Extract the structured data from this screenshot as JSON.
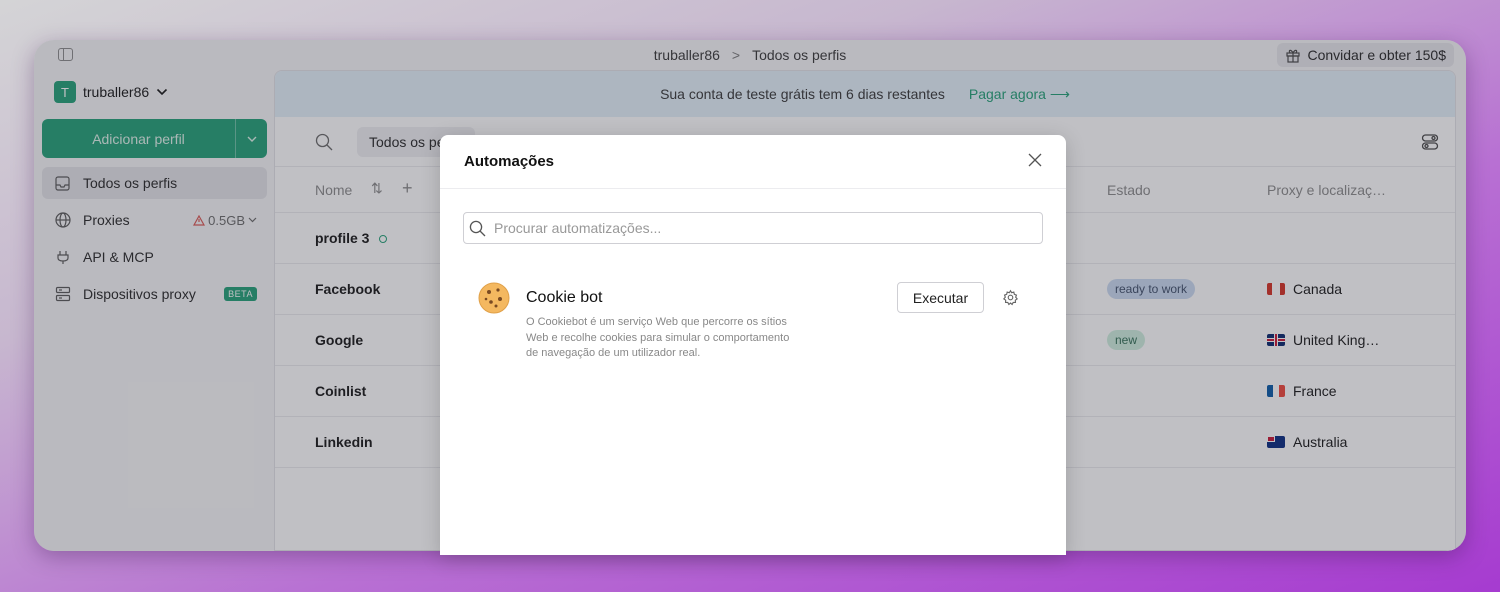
{
  "titlebar": {
    "account": "truballer86",
    "separator": ">",
    "page": "Todos os perfis",
    "invite": "Convidar e obter 150$"
  },
  "sidebar": {
    "account_name": "truballer86",
    "avatar_letter": "T",
    "add_profile": "Adicionar perfil",
    "items": [
      {
        "label": "Todos os perfis",
        "icon": "inbox-icon",
        "active": true
      },
      {
        "label": "Proxies",
        "icon": "globe-icon",
        "extra": "0.5GB"
      },
      {
        "label": "API & MCP",
        "icon": "plug-icon"
      },
      {
        "label": "Dispositivos proxy",
        "icon": "server-icon",
        "badge": "BETA"
      }
    ]
  },
  "banner": {
    "text": "Sua conta de teste grátis tem 6 dias restantes",
    "cta": "Pagar agora"
  },
  "toolbar": {
    "filter_chip": "Todos os perfis"
  },
  "table": {
    "columns": {
      "name": "Nome",
      "status": "Estado",
      "proxy": "Proxy e localizaç…"
    },
    "rows": [
      {
        "name": "profile 3",
        "online": true,
        "status": "",
        "proxy": ""
      },
      {
        "name": "Facebook",
        "status": "ready to work",
        "status_color": "#c9d9f0",
        "proxy": "Canada",
        "flag": "ca"
      },
      {
        "name": "Google",
        "status": "new",
        "status_color": "#cdeedd",
        "proxy": "United King…",
        "flag": "gb"
      },
      {
        "name": "Coinlist",
        "status": "",
        "proxy": "France",
        "flag": "fr"
      },
      {
        "name": "Linkedin",
        "status": "",
        "proxy": "Australia",
        "flag": "au"
      }
    ]
  },
  "modal": {
    "title": "Automações",
    "search_placeholder": "Procurar automatizações...",
    "automations": [
      {
        "name": "Cookie bot",
        "icon": "cookie-icon",
        "description": "O Cookiebot é um serviço Web que percorre os sítios Web e recolhe cookies para simular o comportamento de navegação de um utilizador real.",
        "run_label": "Executar"
      }
    ]
  },
  "colors": {
    "accent": "#1d9e73",
    "banner_bg": "#e3f1fa",
    "warning": "#d9534f"
  }
}
